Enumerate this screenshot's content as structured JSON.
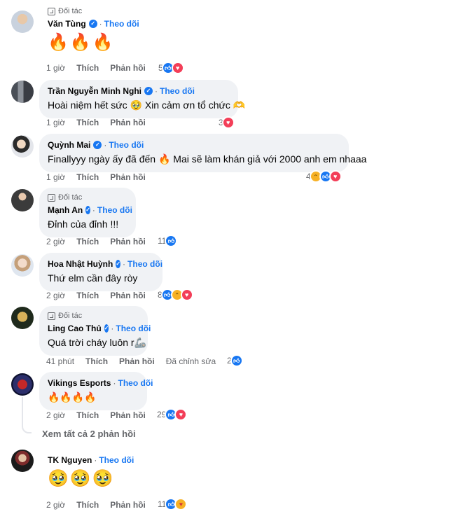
{
  "labels": {
    "partner": "Đối tác",
    "follow": "Theo dõi",
    "like": "Thích",
    "reply": "Phản hồi",
    "edited": "Đã chỉnh sửa",
    "view_replies": "Xem tất cả 2 phản hồi"
  },
  "comments": [
    {
      "author": "Văn Tùng",
      "partner": true,
      "emoji": [
        "🔥",
        "🔥",
        "🔥"
      ],
      "time": "1 giờ",
      "reaction_count": "5",
      "reactions": [
        "like",
        "love"
      ]
    },
    {
      "author": "Trần Nguyễn Minh Nghi",
      "partner": false,
      "text": "Hoài niệm hết sức 🥹 Xin cảm ơn tổ chức 🫶",
      "time": "1 giờ",
      "reaction_count": "3",
      "reactions": [
        "love"
      ]
    },
    {
      "author": "Quỳnh Mai",
      "partner": false,
      "text": "Finallyyy ngày ấy đã đến 🔥 Mai sẽ làm khán giả với 2000 anh em nhaaa",
      "time": "1 giờ",
      "reaction_count": "4",
      "reactions": [
        "haha",
        "like",
        "love"
      ]
    },
    {
      "author": "Mạnh An",
      "partner": true,
      "text": "Đỉnh của đỉnh !!!",
      "time": "2 giờ",
      "reaction_count": "11",
      "reactions": [
        "like"
      ]
    },
    {
      "author": "Hoa Nhật Huỳnh",
      "partner": false,
      "text": "Thứ elm cần đây ròy",
      "time": "2 giờ",
      "reaction_count": "8",
      "reactions": [
        "like",
        "haha",
        "love"
      ]
    },
    {
      "author": "Ling Cao Thủ",
      "partner": true,
      "text": "Quá trời cháy luôn r🦾",
      "time": "41 phút",
      "edited": true,
      "reaction_count": "2",
      "reactions": [
        "like"
      ]
    },
    {
      "author": "Vikings Esports",
      "partner": false,
      "text": "🔥🔥🔥🔥",
      "time": "2 giờ",
      "reaction_count": "29",
      "reactions": [
        "like",
        "love"
      ]
    },
    {
      "author": "TK Nguyen",
      "partner": false,
      "emoji": [
        "🥹",
        "🥹",
        "🥹"
      ],
      "time": "2 giờ",
      "reaction_count": "11",
      "reactions": [
        "like",
        "care"
      ]
    }
  ],
  "colors": {
    "follow": "#1877f2",
    "bubble": "#f0f2f5",
    "muted": "#65676b",
    "like": "#1877f2",
    "love": "#f33e58",
    "haha": "#f7b125"
  },
  "icons": {
    "partner": "partner-badge-icon",
    "verified": "verified-check-icon",
    "like": "thumbs-up-icon",
    "love": "heart-icon",
    "haha": "laughing-face-icon",
    "care": "care-hug-face-icon"
  }
}
